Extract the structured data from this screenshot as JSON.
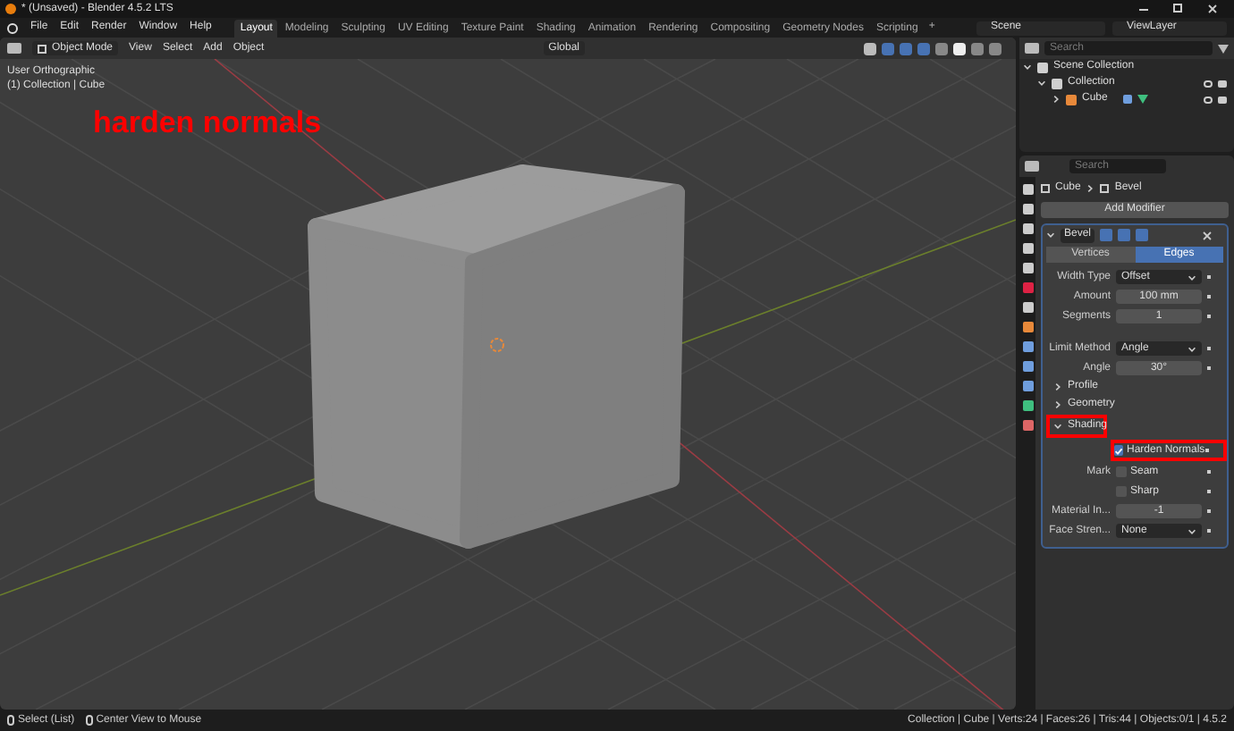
{
  "window": {
    "title": "* (Unsaved) - Blender 4.5.2 LTS"
  },
  "menu": [
    "File",
    "Edit",
    "Render",
    "Window",
    "Help"
  ],
  "workspaces": [
    {
      "label": "Layout",
      "selected": true
    },
    {
      "label": "Modeling",
      "selected": false
    },
    {
      "label": "Sculpting",
      "selected": false
    },
    {
      "label": "UV Editing",
      "selected": false
    },
    {
      "label": "Texture Paint",
      "selected": false
    },
    {
      "label": "Shading",
      "selected": false
    },
    {
      "label": "Animation",
      "selected": false
    },
    {
      "label": "Rendering",
      "selected": false
    },
    {
      "label": "Compositing",
      "selected": false
    },
    {
      "label": "Geometry Nodes",
      "selected": false
    },
    {
      "label": "Scripting",
      "selected": false
    }
  ],
  "add_workspace": "+",
  "scene": "Scene",
  "view_layer": "ViewLayer",
  "viewport": {
    "mode": "Object Mode",
    "menus": [
      "View",
      "Select",
      "Add",
      "Object"
    ],
    "orientation": "Global",
    "view_name": "User Orthographic",
    "context": "(1) Collection | Cube",
    "annotation": "harden normals"
  },
  "outliner": {
    "search": {
      "placeholder": "Search"
    },
    "tree": [
      {
        "label": "Scene Collection",
        "expanded": true,
        "children": [
          {
            "label": "Collection",
            "expanded": true,
            "children": [
              {
                "label": "Cube",
                "expanded": false
              }
            ]
          }
        ]
      }
    ]
  },
  "properties": {
    "search": {
      "placeholder": "Search"
    },
    "breadcrumb": [
      "Cube",
      "Bevel"
    ],
    "add_modifier": "Add Modifier",
    "modifier_name": "Bevel",
    "affect": [
      {
        "label": "Vertices",
        "selected": false
      },
      {
        "label": "Edges",
        "selected": true
      }
    ],
    "fields": [
      {
        "kind": "dropdown",
        "label": "Width Type",
        "value": "Offset"
      },
      {
        "kind": "number",
        "label": "Amount",
        "value": "100 mm"
      },
      {
        "kind": "number",
        "label": "Segments",
        "value": "1"
      },
      {
        "kind": "gap"
      },
      {
        "kind": "dropdown",
        "label": "Limit Method",
        "value": "Angle"
      },
      {
        "kind": "number",
        "label": "Angle",
        "value": "30°"
      }
    ],
    "sections": [
      {
        "label": "Profile",
        "expanded": false,
        "highlighted": false
      },
      {
        "label": "Geometry",
        "expanded": false,
        "highlighted": false
      },
      {
        "label": "Shading",
        "expanded": true,
        "highlighted": true
      }
    ],
    "shading": [
      {
        "kind": "checkbox",
        "label": "Harden Normals",
        "checked": true,
        "highlighted": true
      },
      {
        "kind": "checkbox",
        "side_label": "Mark",
        "label": "Seam",
        "checked": false,
        "highlighted": false
      },
      {
        "kind": "checkbox",
        "label": "Sharp",
        "checked": false,
        "highlighted": false
      },
      {
        "kind": "number",
        "label": "Material In...",
        "value": "-1"
      },
      {
        "kind": "dropdown",
        "label": "Face Stren...",
        "value": "None"
      }
    ]
  },
  "status_bar": {
    "left": [
      "Select (List)",
      "Center View to Mouse"
    ],
    "right": "Collection | Cube | Verts:24 | Faces:26 | Tris:44 | Objects:0/1 | 4.5.2"
  }
}
